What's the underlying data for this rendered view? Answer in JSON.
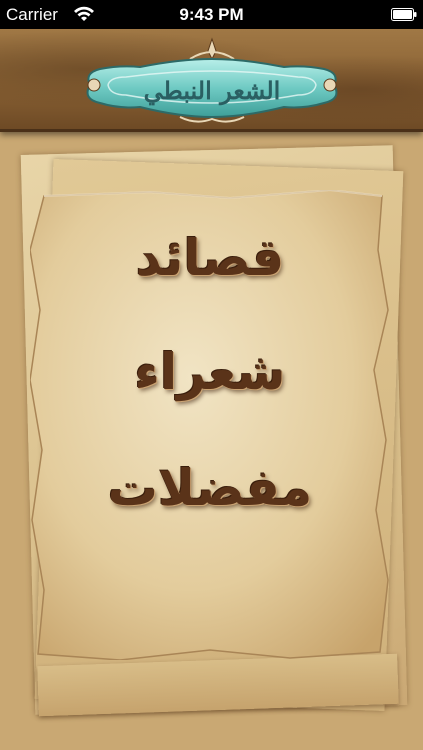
{
  "status_bar": {
    "carrier": "Carrier",
    "time": "9:43 PM"
  },
  "header": {
    "title": "الشعر النبطي",
    "ornament_color": "#7ccfc9"
  },
  "menu": {
    "items": [
      {
        "label": "قصائد"
      },
      {
        "label": "شعراء"
      },
      {
        "label": "مفضلات"
      }
    ]
  },
  "colors": {
    "text_brown": "#5a3319",
    "paper": "#e8d5a8",
    "header_wood": "#8a6234"
  }
}
